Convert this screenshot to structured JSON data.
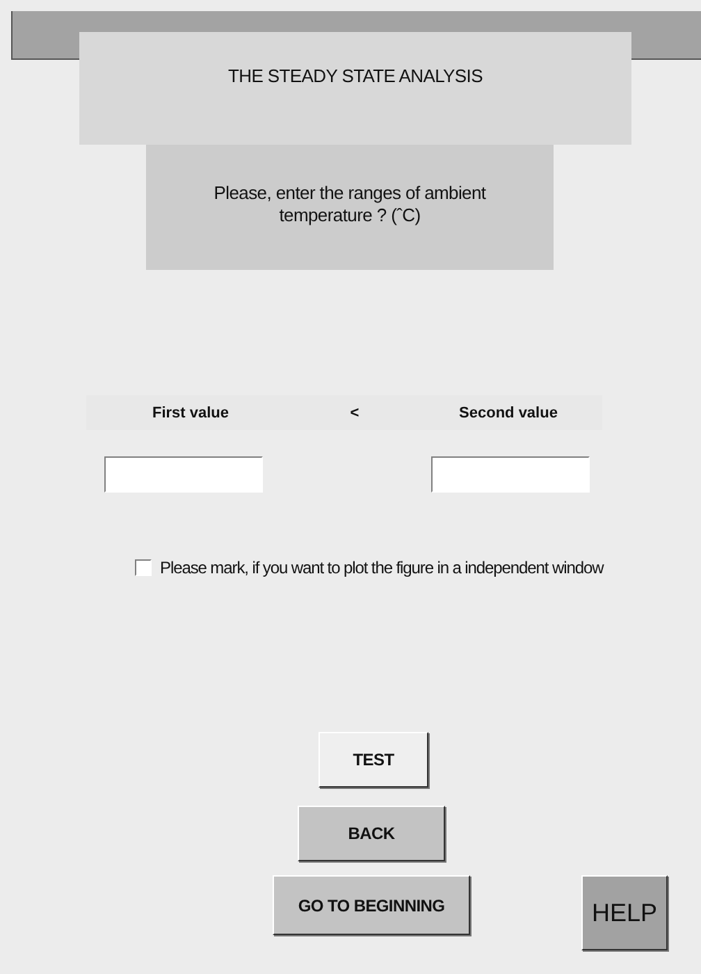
{
  "title": "THE STEADY STATE ANALYSIS",
  "prompt": "Please, enter the ranges of ambient temperature ?  (ˆC)",
  "range": {
    "separator": "<",
    "inputs": [
      {
        "label": "First value"
      },
      {
        "label": "Second value"
      }
    ]
  },
  "checkbox": {
    "label": "Please mark, if  you want to plot the figure in a independent window",
    "checked": false
  },
  "buttons": [
    {
      "label": "TEST",
      "kind": "light"
    },
    {
      "label": "BACK",
      "kind": "normal"
    },
    {
      "label": "GO TO BEGINNING",
      "kind": "normal"
    }
  ],
  "help": {
    "label": "HELP"
  }
}
